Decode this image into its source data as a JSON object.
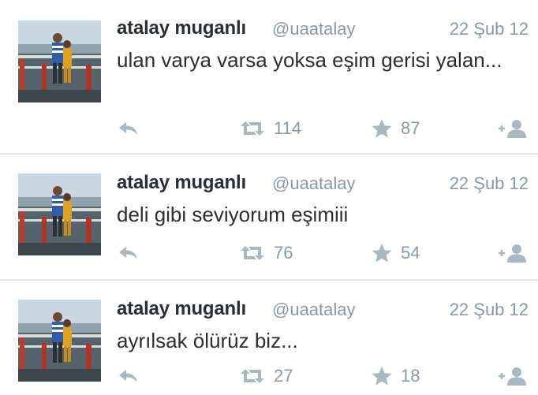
{
  "colors": {
    "name": "#292f33",
    "meta": "#8899a6",
    "icon": "#aab8c2",
    "divider": "#e1e8ed"
  },
  "tweets": [
    {
      "name": "atalay muganlı",
      "handle": "@uaatalay",
      "date": "22 Şub 12",
      "text": "ulan varya varsa yoksa eşim gerisi yalan...",
      "retweets": "114",
      "favorites": "87"
    },
    {
      "name": "atalay muganlı",
      "handle": "@uaatalay",
      "date": "22 Şub 12",
      "text": "deli gibi seviyorum eşimiii",
      "retweets": "76",
      "favorites": "54"
    },
    {
      "name": "atalay muganlı",
      "handle": "@uaatalay",
      "date": "22 Şub 12",
      "text": "ayrılsak ölürüz biz...",
      "retweets": "27",
      "favorites": "18"
    }
  ],
  "icons": {
    "reply": "reply-icon",
    "retweet": "retweet-icon",
    "favorite": "star-icon",
    "follow": "follow-icon"
  }
}
